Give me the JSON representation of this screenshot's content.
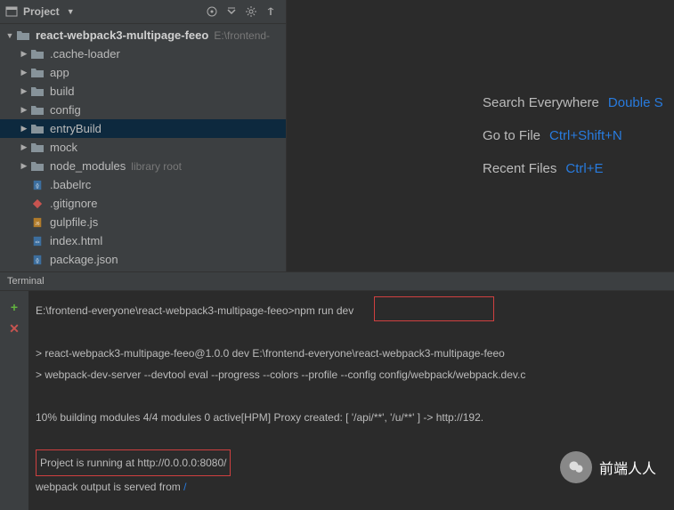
{
  "header": {
    "title": "Project"
  },
  "tree": {
    "root": {
      "name": "react-webpack3-multipage-feeo",
      "path": "E:\\frontend-"
    },
    "items": [
      {
        "name": ".cache-loader",
        "type": "folder",
        "arrow": true
      },
      {
        "name": "app",
        "type": "folder",
        "arrow": true
      },
      {
        "name": "build",
        "type": "folder",
        "arrow": true
      },
      {
        "name": "config",
        "type": "folder",
        "arrow": true
      },
      {
        "name": "entryBuild",
        "type": "folder",
        "arrow": true,
        "selected": true
      },
      {
        "name": "mock",
        "type": "folder",
        "arrow": true
      },
      {
        "name": "node_modules",
        "type": "folder",
        "arrow": true,
        "hint": "library root"
      },
      {
        "name": ".babelrc",
        "type": "json-file",
        "arrow": false
      },
      {
        "name": ".gitignore",
        "type": "git-file",
        "arrow": false
      },
      {
        "name": "gulpfile.js",
        "type": "js-file",
        "arrow": false
      },
      {
        "name": "index.html",
        "type": "html-file",
        "arrow": false
      },
      {
        "name": "package.json",
        "type": "json-file",
        "arrow": false
      }
    ]
  },
  "welcome": {
    "lines": [
      {
        "text": "Search Everywhere",
        "shortcut": "Double S"
      },
      {
        "text": "Go to File",
        "shortcut": "Ctrl+Shift+N"
      },
      {
        "text": "Recent Files",
        "shortcut": "Ctrl+E"
      }
    ]
  },
  "terminal": {
    "tab": "Terminal",
    "prompt_path": "E:\\frontend-everyone\\react-webpack3-multipage-feeo>",
    "prompt_cmd": "npm run dev",
    "lines": [
      "> react-webpack3-multipage-feeo@1.0.0 dev E:\\frontend-everyone\\react-webpack3-multipage-feeo",
      "> webpack-dev-server --devtool eval --progress --colors --profile --config config/webpack/webpack.dev.c",
      " 10% building modules 4/4 modules 0 active[HPM] Proxy created: [ '/api/**', '/u/**' ]  ->  http://192.",
      "webpack output is served from"
    ],
    "running_line": "Project is running at http://0.0.0.0:8080/",
    "served_slash": "/"
  },
  "watermark": {
    "text": "前端人人"
  }
}
